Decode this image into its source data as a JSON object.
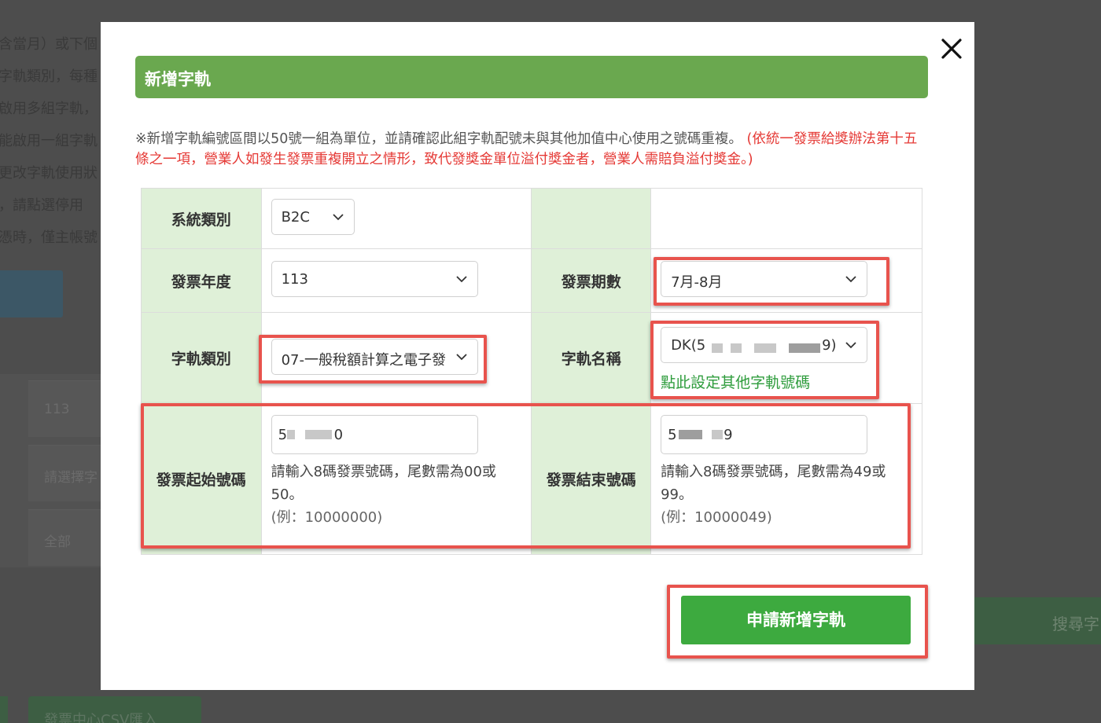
{
  "background": {
    "lines": [
      "含當月）或下個",
      "字軌類別，每種",
      "啟用多組字軌，",
      "能啟用一組字軌",
      "更改字軌使用狀",
      "，請點選停用 ",
      "憑時，僅主帳號"
    ],
    "cells": [
      "113",
      "請選擇字",
      "全部"
    ],
    "right_button": "搜尋字",
    "bottom_button": "發票中心CSV匯入"
  },
  "modal": {
    "title": "新增字軌",
    "close_icon": "close-icon",
    "notice_text": "※新增字軌編號區間以50號一組為單位，並請確認此組字軌配號未與其他加值中心使用之號碼重複。",
    "notice_warning": "(依統一發票給獎辦法第十五條之一項，營業人如發生發票重複開立之情形，致代發獎金單位溢付獎金者，營業人需賠負溢付獎金。)",
    "form": {
      "system_type_label": "系統類別",
      "system_type_value": "B2C",
      "invoice_year_label": "發票年度",
      "invoice_year_value": "113",
      "invoice_period_label": "發票期數",
      "invoice_period_value": "7月-8月",
      "track_type_label": "字軌類別",
      "track_type_value": "07-一般稅額計算之電子發",
      "track_name_label": "字軌名稱",
      "track_name_prefix": "DK(5",
      "track_name_suffix": "9)",
      "track_name_link": "點此設定其他字軌號碼",
      "start_no_label": "發票起始號碼",
      "start_no_prefix": "5",
      "start_no_suffix": "0",
      "start_no_hint": "請輸入8碼發票號碼，尾數需為00或50。",
      "start_no_example": "(例：10000000)",
      "end_no_label": "發票結束號碼",
      "end_no_prefix": "5",
      "end_no_suffix": "9",
      "end_no_hint": "請輸入8碼發票號碼，尾數需為49或99。",
      "end_no_example": "(例：10000049)"
    },
    "submit_label": "申請新增字軌"
  },
  "colors": {
    "header_green": "#6aa84f",
    "label_bg": "#dff0d8",
    "submit_green": "#3daa3f",
    "warning_red": "#e53935",
    "highlight_red": "#e8534d",
    "link_green": "#2e9c3c"
  }
}
